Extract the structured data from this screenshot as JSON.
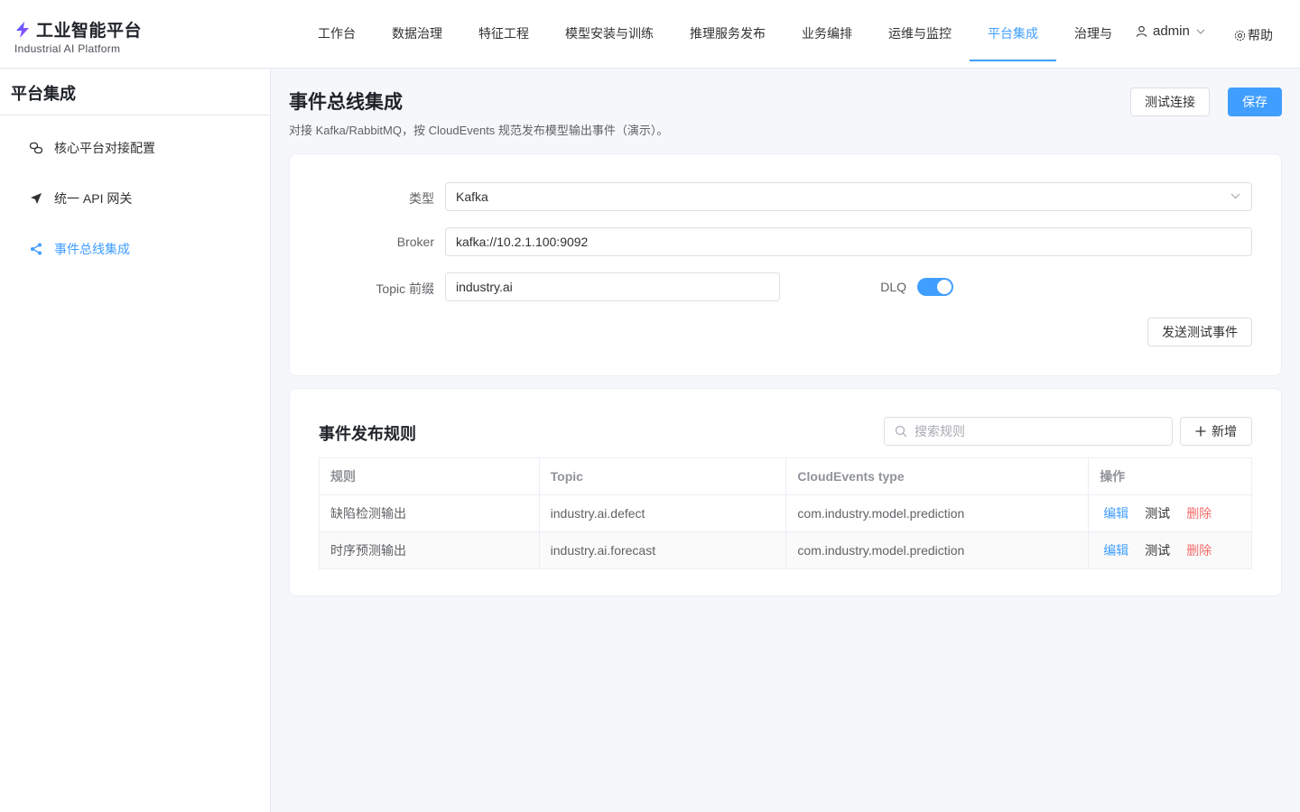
{
  "header": {
    "logo_title": "工业智能平台",
    "logo_subtitle": "Industrial AI Platform",
    "nav": [
      "工作台",
      "数据治理",
      "特征工程",
      "模型安装与训练",
      "推理服务发布",
      "业务编排",
      "运维与监控",
      "平台集成",
      "治理与"
    ],
    "active_nav": "平台集成",
    "user": "admin",
    "help": "帮助"
  },
  "sidebar": {
    "title": "平台集成",
    "items": [
      {
        "label": "核心平台对接配置",
        "icon": "link-icon"
      },
      {
        "label": "统一 API 网关",
        "icon": "send-icon"
      },
      {
        "label": "事件总线集成",
        "icon": "share-icon"
      }
    ],
    "active": "事件总线集成"
  },
  "page": {
    "title": "事件总线集成",
    "description": "对接 Kafka/RabbitMQ，按 CloudEvents 规范发布模型输出事件（演示）。",
    "test_connection": "测试连接",
    "save": "保存"
  },
  "form": {
    "type_label": "类型",
    "type_value": "Kafka",
    "broker_label": "Broker",
    "broker_value": "kafka://10.2.1.100:9092",
    "topic_prefix_label": "Topic 前缀",
    "topic_prefix_value": "industry.ai",
    "dlq_label": "DLQ",
    "dlq_enabled": true,
    "send_test_event": "发送测试事件"
  },
  "rules": {
    "title": "事件发布规则",
    "search_placeholder": "搜索规则",
    "add_label": "新增",
    "columns": [
      "规则",
      "Topic",
      "CloudEvents type",
      "操作"
    ],
    "rows": [
      {
        "name": "缺陷检测输出",
        "topic": "industry.ai.defect",
        "type": "com.industry.model.prediction"
      },
      {
        "name": "时序预测输出",
        "topic": "industry.ai.forecast",
        "type": "com.industry.model.prediction"
      }
    ],
    "actions": {
      "edit": "编辑",
      "test": "测试",
      "delete": "删除"
    }
  },
  "colors": {
    "primary": "#409eff",
    "danger": "#f56c6c",
    "logo": "#7c3aed"
  }
}
